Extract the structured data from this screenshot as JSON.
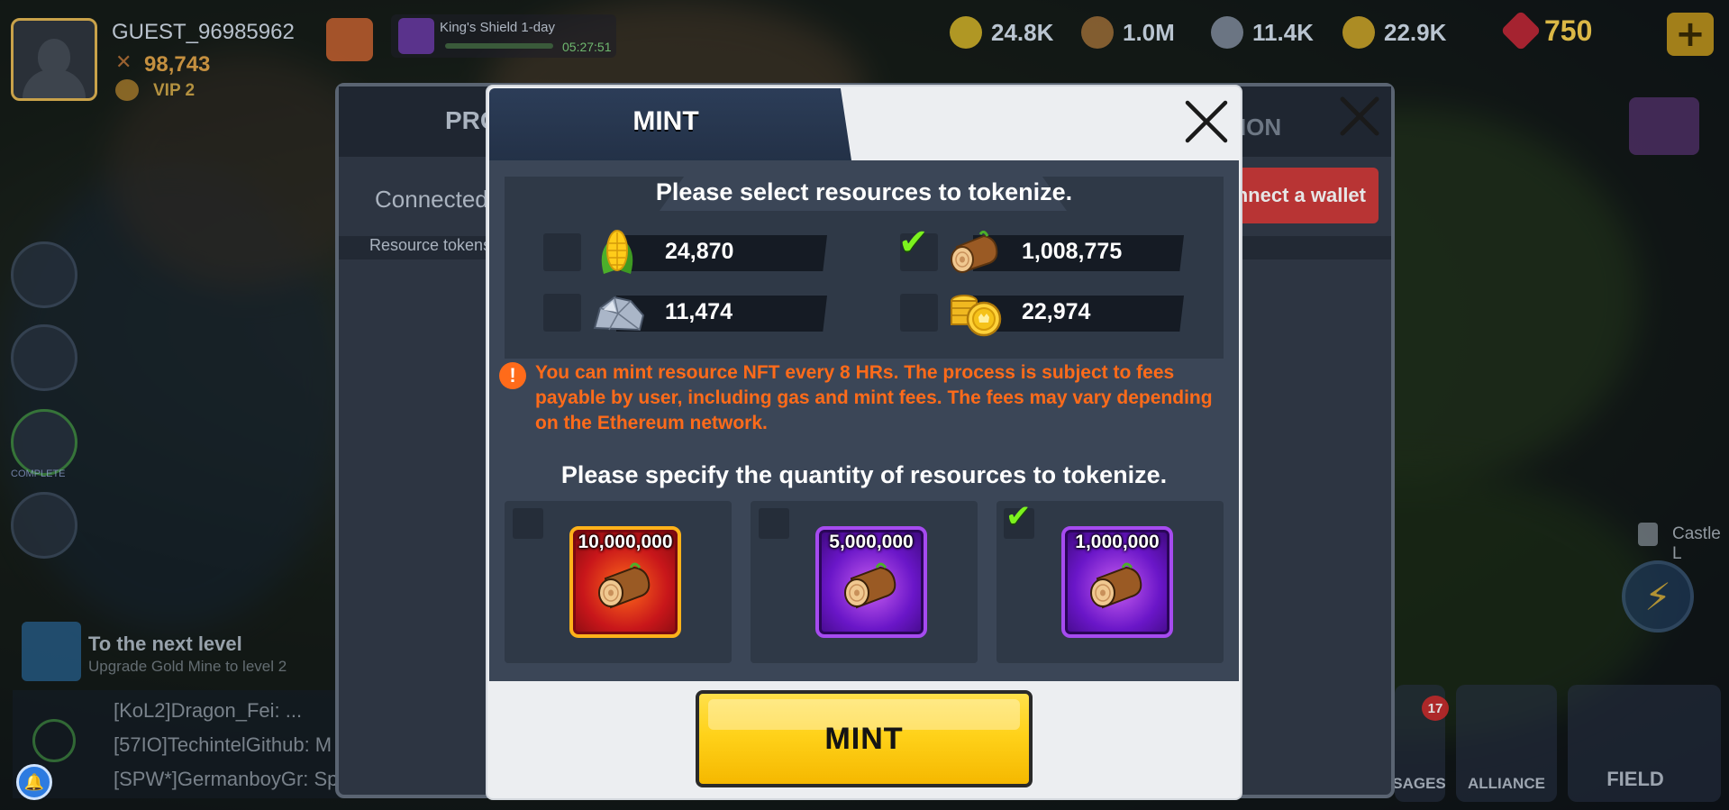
{
  "hud": {
    "player_name": "GUEST_96985962",
    "power": "98,743",
    "vip": "VIP 2",
    "buff_title": "King's Shield 1-day",
    "buff_time": "05:27:51",
    "resources": [
      {
        "icon": "corn-icon",
        "value": "24.8K"
      },
      {
        "icon": "wood-icon",
        "value": "1.0M"
      },
      {
        "icon": "stone-icon",
        "value": "11.4K"
      },
      {
        "icon": "gold-icon",
        "value": "22.9K"
      }
    ],
    "gems": "750"
  },
  "left": {
    "complete_label": "COMPLETE",
    "next_level_title": "To the next level",
    "next_level_sub": "Upgrade Gold Mine to level 2",
    "chat": [
      "[KoL2]Dragon_Fei: ...",
      "[57IO]TechintelGithub: M",
      "[SPW*]GermanboyGr: Sp"
    ]
  },
  "right": {
    "castle_label": "Castle L",
    "messages_label": "SAGES",
    "messages_badge": "17",
    "alliance_label": "ALLIANCE",
    "field_label": "FIELD"
  },
  "back_dialog": {
    "tab_left": "PRO",
    "tab_right": "TION",
    "connected": "Connected",
    "resource_tokens": "Resource tokens",
    "wallet_button": "nnect a wallet"
  },
  "mint": {
    "tab_title": "MINT",
    "select_title": "Please select resources to tokenize.",
    "resources": [
      {
        "name": "corn",
        "icon": "corn-icon",
        "value": "24,870",
        "checked": false
      },
      {
        "name": "wood",
        "icon": "wood-icon",
        "value": "1,008,775",
        "checked": true
      },
      {
        "name": "stone",
        "icon": "stone-icon",
        "value": "11,474",
        "checked": false
      },
      {
        "name": "gold",
        "icon": "gold-icon",
        "value": "22,974",
        "checked": false
      }
    ],
    "warning": "You can mint resource NFT every 8 HRs. The process is subject to fees payable by user, including gas and mint fees. The fees may vary depending on the Ethereum network.",
    "quantity_title": "Please specify the quantity of resources to tokenize.",
    "quantities": [
      {
        "label": "10,000,000",
        "style": "red",
        "checked": false
      },
      {
        "label": "5,000,000",
        "style": "purple",
        "checked": false
      },
      {
        "label": "1,000,000",
        "style": "purple",
        "checked": true
      }
    ],
    "button_label": "MINT",
    "check_glyph": "✔"
  },
  "colors": {
    "accent_yellow": "#ffd21a",
    "warning_orange": "#ff6b1a",
    "check_green": "#7cf21e",
    "panel_dark": "#2f3947",
    "modal_header": "#233147"
  }
}
